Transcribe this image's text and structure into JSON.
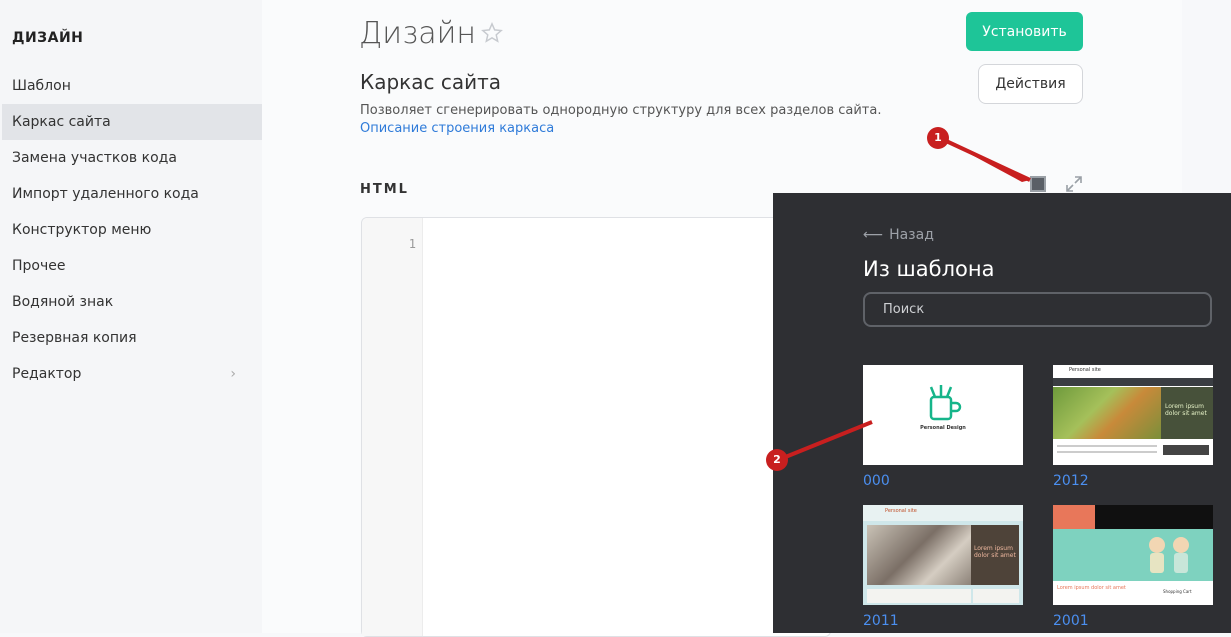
{
  "sidebar": {
    "title": "ДИЗАЙН",
    "items": [
      {
        "label": "Шаблон"
      },
      {
        "label": "Каркас сайта",
        "active": true
      },
      {
        "label": "Замена участков кода"
      },
      {
        "label": "Импорт удаленного кода"
      },
      {
        "label": "Конструктор меню"
      },
      {
        "label": "Прочее"
      },
      {
        "label": "Водяной знак"
      },
      {
        "label": "Резервная копия"
      },
      {
        "label": "Редактор",
        "has_submenu": true
      }
    ]
  },
  "header": {
    "title": "Дизайн",
    "install_label": "Установить",
    "actions_label": "Действия"
  },
  "section": {
    "title": "Каркас сайта",
    "description": "Позволяет сгенерировать однородную структуру для всех разделов сайта.",
    "link": "Описание строения каркаса"
  },
  "editor": {
    "label": "HTML",
    "line_number": "1"
  },
  "panel": {
    "back_label": "Назад",
    "title": "Из шаблона",
    "search_placeholder": "Поиск",
    "templates": [
      {
        "name": "000",
        "thumb_text": "Personal Design"
      },
      {
        "name": "2012",
        "thumb_title": "Personal site",
        "thumb_caption": "Lorem ipsum dolor sit amet"
      },
      {
        "name": "2011",
        "thumb_title": "Personal site",
        "thumb_caption": "Lorem ipsum dolor sit amet"
      },
      {
        "name": "2001",
        "thumb_caption": "Lorem ipsum dolor sit amet",
        "thumb_side": "Shopping Cart"
      }
    ]
  },
  "callouts": [
    "1",
    "2"
  ],
  "colors": {
    "accent": "#1ec598",
    "link": "#2f7bd9",
    "panel_bg": "#2e2f33",
    "callout": "#c81f1f"
  }
}
